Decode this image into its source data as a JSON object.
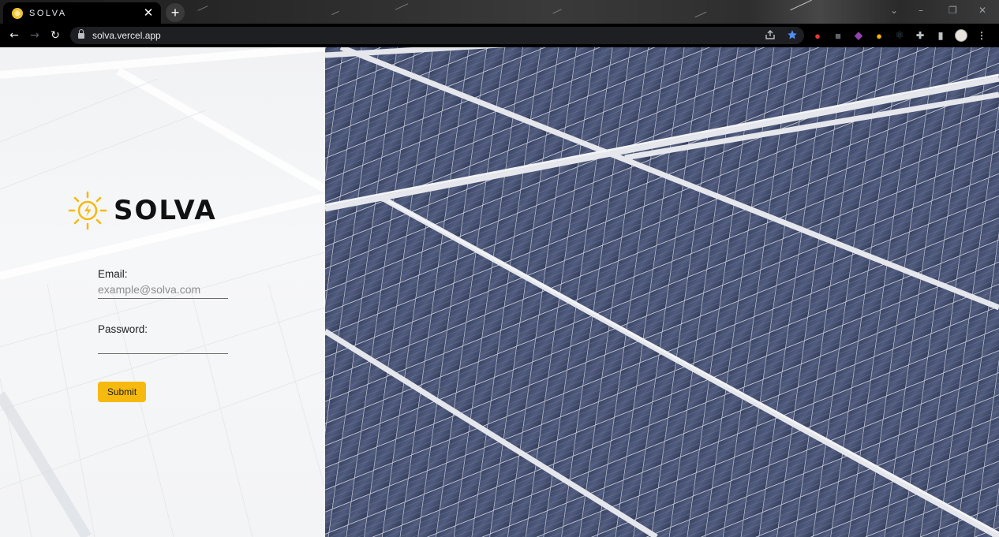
{
  "browser": {
    "tab": {
      "title": "SOLVA",
      "close_glyph": "✕"
    },
    "new_tab_glyph": "+",
    "url": "solva.vercel.app",
    "window_controls": {
      "chevron": "⌄",
      "minimize": "–",
      "restore": "❐",
      "close": "✕"
    },
    "nav": {
      "back": "←",
      "forward": "→",
      "reload": "↻"
    },
    "extensions": [
      {
        "name": "adblock-icon",
        "color": "#e53935",
        "glyph": "●"
      },
      {
        "name": "extension-icon",
        "color": "#5f6368",
        "glyph": "■"
      },
      {
        "name": "gradient-extension-icon",
        "color": "#8e44ad",
        "glyph": "◆"
      },
      {
        "name": "chrome-icon",
        "color": "#f4b400",
        "glyph": "●"
      },
      {
        "name": "react-devtools-icon",
        "color": "#1f2a33",
        "glyph": "⚛"
      },
      {
        "name": "puzzle-extensions-icon",
        "color": "#000000",
        "glyph": "✚"
      },
      {
        "name": "side-panel-icon",
        "color": "#000000",
        "glyph": "▮"
      },
      {
        "name": "profile-avatar",
        "color": "#e8e4dc",
        "glyph": ""
      },
      {
        "name": "kebab-menu-icon",
        "color": "#000000",
        "glyph": "⋮"
      }
    ]
  },
  "login": {
    "brand": "SOLVA",
    "email": {
      "label": "Email:",
      "placeholder": "example@solva.com",
      "value": ""
    },
    "password": {
      "label": "Password:",
      "value": ""
    },
    "submit_label": "Submit"
  },
  "colors": {
    "accent": "#f6b90e",
    "sun": "#f6b90e",
    "panel_cell": "#39466a",
    "panel_frame": "#d9dde3"
  }
}
